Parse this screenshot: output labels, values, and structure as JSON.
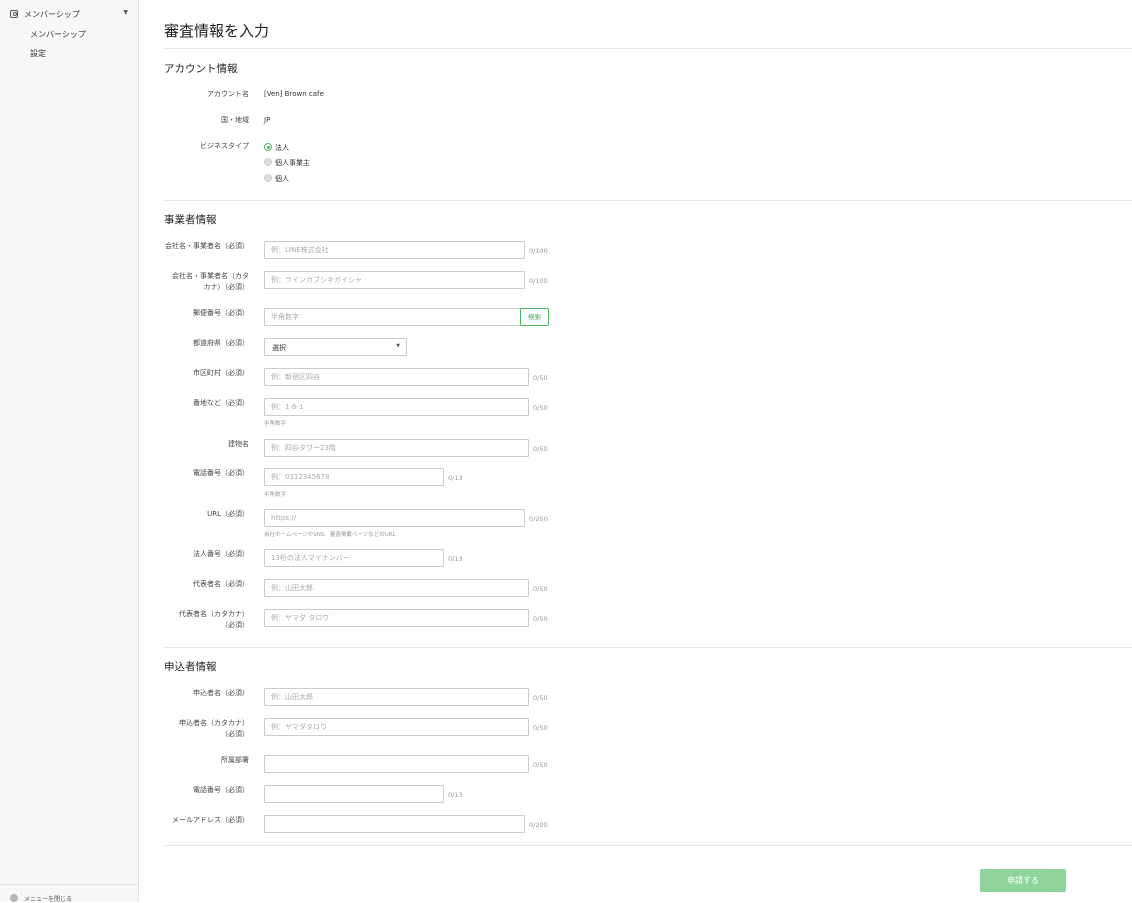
{
  "sidebar": {
    "group_label": "メンバーシップ",
    "items": [
      {
        "label": "メンバーシップ"
      },
      {
        "label": "設定"
      }
    ],
    "footer_label": "メニューを閉じる"
  },
  "page": {
    "title": "審査情報を入力"
  },
  "account": {
    "section_title": "アカウント情報",
    "account_name_label": "アカウント名",
    "account_name_value": "[Ven] Brown cafe",
    "country_label": "国・地域",
    "country_value": "JP",
    "business_type_label": "ビジネスタイプ",
    "business_type_options": [
      "法人",
      "個人事業主",
      "個人"
    ],
    "business_type_selected": "法人"
  },
  "business": {
    "section_title": "事業者情報",
    "company_name": {
      "label": "会社名・事業者名（必須）",
      "placeholder": "例：LINE株式会社",
      "count": "0/100"
    },
    "company_kana": {
      "label1": "会社名・事業者名（カタ",
      "label2": "カナ）（必須）",
      "placeholder": "例：ラインカブシキガイシャ",
      "count": "0/100"
    },
    "postal": {
      "label": "郵便番号（必須）",
      "placeholder": "半角数字",
      "search_label": "検索"
    },
    "prefecture": {
      "label": "都道府県（必須）",
      "value": "選択"
    },
    "city": {
      "label": "市区町村（必須）",
      "placeholder": "例：新宿区四谷",
      "count": "0/50"
    },
    "address": {
      "label": "番地など（必須）",
      "placeholder": "例：1-6-1",
      "count": "0/50",
      "hint": "半角数字"
    },
    "building": {
      "label": "建物名",
      "placeholder": "例：四谷タワー23階",
      "count": "0/50"
    },
    "phone": {
      "label": "電話番号（必須）",
      "placeholder": "例：0312345678",
      "count": "0/13",
      "hint": "半角数字"
    },
    "url": {
      "label": "URL（必須）",
      "placeholder": "https://",
      "count": "0/250",
      "hint": "自社ホームページやSNS、審査掲載ページなどのURL"
    },
    "corp_number": {
      "label": "法人番号（必須）",
      "placeholder": "13桁の法人マイナンバー",
      "count": "0/13"
    },
    "rep_name": {
      "label": "代表者名（必須）",
      "placeholder": "例：山田太郎",
      "count": "0/50"
    },
    "rep_kana": {
      "label1": "代表者名（カタカナ）",
      "label2": "（必須）",
      "placeholder": "例：ヤマダ タロウ",
      "count": "0/50"
    }
  },
  "applicant": {
    "section_title": "申込者情報",
    "name": {
      "label": "申込者名（必須）",
      "placeholder": "例：山田太郎",
      "count": "0/50"
    },
    "kana": {
      "label1": "申込者名（カタカナ）",
      "label2": "（必須）",
      "placeholder": "例：ヤマダタロウ",
      "count": "0/50"
    },
    "department": {
      "label": "所属部署",
      "placeholder": "",
      "count": "0/50"
    },
    "phone": {
      "label": "電話番号（必須）",
      "placeholder": "",
      "count": "0/13"
    },
    "email": {
      "label": "メールアドレス（必須）",
      "placeholder": "",
      "count": "0/200"
    }
  },
  "submit": {
    "label": "申請する"
  },
  "colors": {
    "accent": "#4cb45c",
    "submit_bg": "#8fd49a"
  },
  "icons": {
    "group": "user-icon",
    "group_toggle": "chevron-down-icon",
    "footer": "circle-icon"
  }
}
